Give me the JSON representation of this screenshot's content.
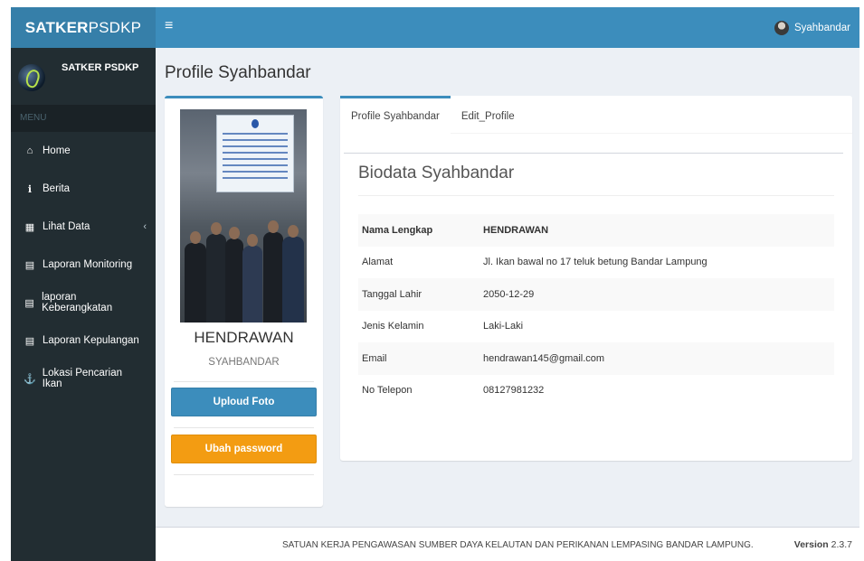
{
  "brand": {
    "bold": "SATKER",
    "light": "PSDKP"
  },
  "user_panel": {
    "name": "SATKER PSDKP"
  },
  "menu_header": "MENU",
  "nav": [
    {
      "icon": "home-icon",
      "glyph": "⌂",
      "label": "Home"
    },
    {
      "icon": "info-circle-icon",
      "glyph": "ℹ",
      "label": "Berita"
    },
    {
      "icon": "table-icon",
      "glyph": "▦",
      "label": "Lihat Data",
      "chevron": "‹"
    },
    {
      "icon": "list-icon",
      "glyph": "▤",
      "label": "Laporan Monitoring"
    },
    {
      "icon": "list-icon",
      "glyph": "▤",
      "label": "laporan Keberangkatan"
    },
    {
      "icon": "list-icon",
      "glyph": "▤",
      "label": "Laporan Kepulangan"
    },
    {
      "icon": "anchor-icon",
      "glyph": "⚓",
      "label": "Lokasi Pencarian Ikan"
    }
  ],
  "header": {
    "toggle": "≡",
    "user": "Syahbandar"
  },
  "page_title": "Profile Syahbandar",
  "profile": {
    "name": "HENDRAWAN",
    "role": "SYAHBANDAR",
    "upload_label": "Uploud Foto",
    "password_label": "Ubah password"
  },
  "tabs": [
    "Profile Syahbandar",
    "Edit_Profile"
  ],
  "bio": {
    "title": "Biodata Syahbandar",
    "rows": [
      {
        "key": "Nama Lengkap",
        "value": "HENDRAWAN"
      },
      {
        "key": "Alamat",
        "value": "Jl. Ikan bawal no 17 teluk betung Bandar Lampung"
      },
      {
        "key": "Tanggal Lahir",
        "value": "2050-12-29"
      },
      {
        "key": "Jenis Kelamin",
        "value": "Laki-Laki"
      },
      {
        "key": "Email",
        "value": "hendrawan145@gmail.com"
      },
      {
        "key": "No Telepon",
        "value": "08127981232"
      }
    ]
  },
  "footer": {
    "text": "SATUAN KERJA PENGAWASAN SUMBER DAYA KELAUTAN DAN PERIKANAN LEMPASING BANDAR LAMPUNG.",
    "version_label": "Version",
    "version": "2.3.7"
  },
  "colors": {
    "primary": "#3c8dbc",
    "sidebar": "#222d32",
    "warning": "#f39c12"
  }
}
